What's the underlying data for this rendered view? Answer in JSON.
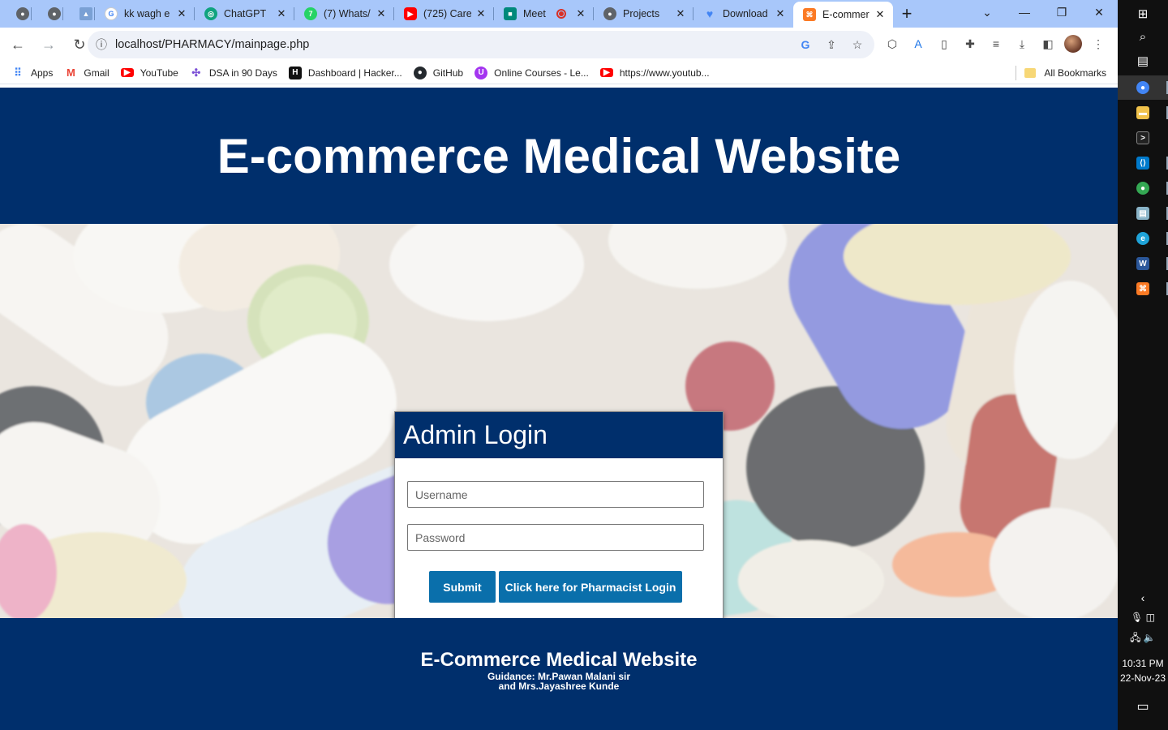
{
  "browser": {
    "tabs": [
      {
        "title": "",
        "favicon": "globe-icon",
        "color": "#5f6368",
        "active": false
      },
      {
        "title": "",
        "favicon": "globe-icon",
        "color": "#5f6368",
        "active": false
      },
      {
        "title": "",
        "favicon": "image-icon",
        "color": "#7aa0d4",
        "active": false
      },
      {
        "title": "kk wagh e",
        "favicon": "google-icon",
        "color": "#4285f4",
        "active": false
      },
      {
        "title": "ChatGPT",
        "favicon": "chatgpt-icon",
        "color": "#10a37f",
        "active": false
      },
      {
        "title": "(7) Whats/",
        "favicon": "whatsapp-icon",
        "color": "#25d366",
        "active": false
      },
      {
        "title": "(725) Care",
        "favicon": "youtube-icon",
        "color": "#ff0000",
        "active": false
      },
      {
        "title": "Meet",
        "favicon": "meet-icon",
        "color": "#00897b",
        "active": false
      },
      {
        "title": "Projects",
        "favicon": "globe-icon",
        "color": "#5f6368",
        "active": false
      },
      {
        "title": "Download",
        "favicon": "heart-icon",
        "color": "#4285f4",
        "active": false
      },
      {
        "title": "E-commer",
        "favicon": "xampp-icon",
        "color": "#fb7a24",
        "active": true
      }
    ],
    "url": "localhost/PHARMACY/mainpage.php",
    "bookmarks": [
      {
        "label": "Apps",
        "icon": "apps-grid-icon",
        "color": "#4285f4"
      },
      {
        "label": "Gmail",
        "icon": "gmail-icon",
        "color": "#ea4335"
      },
      {
        "label": "YouTube",
        "icon": "youtube-icon",
        "color": "#ff0000"
      },
      {
        "label": "DSA in 90 Days",
        "icon": "dsa-icon",
        "color": "#7b4fd6"
      },
      {
        "label": "Dashboard | Hacker...",
        "icon": "hackerrank-icon",
        "color": "#111111"
      },
      {
        "label": "GitHub",
        "icon": "github-icon",
        "color": "#24292e"
      },
      {
        "label": "Online Courses - Le...",
        "icon": "courses-icon",
        "color": "#a435f0"
      },
      {
        "label": "https://www.youtub...",
        "icon": "youtube-icon",
        "color": "#ff0000"
      }
    ],
    "all_bookmarks": "All Bookmarks"
  },
  "site": {
    "header_title": "E-commerce Medical Website",
    "login": {
      "heading": "Admin Login",
      "username_placeholder": "Username",
      "password_placeholder": "Password",
      "submit_label": "Submit",
      "pharmacist_label": "Click here for Pharmacist Login"
    },
    "footer": {
      "title": "E-Commerce Medical Website",
      "line1": "Guidance: Mr.Pawan Malani sir",
      "line2": "and Mrs.Jayashree Kunde"
    },
    "colors": {
      "header_bg": "#002f6c",
      "button_bg": "#0a6fab"
    }
  },
  "taskbar": {
    "time": "10:31 PM",
    "date": "22-Nov-23"
  }
}
